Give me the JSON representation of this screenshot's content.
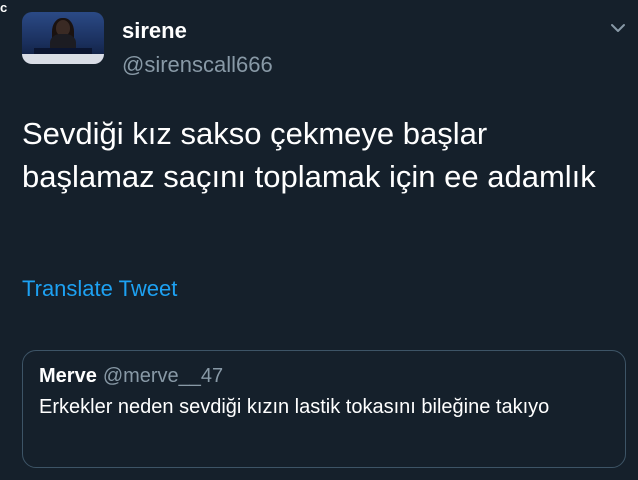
{
  "status_bar": {
    "fragment": "c"
  },
  "tweet": {
    "author": {
      "display_name": "sirene",
      "handle": "@sirenscall666"
    },
    "text": "Sevdiği kız sakso çekmeye başlar başlamaz saçını toplamak için ee adamlık",
    "translate_label": "Translate Tweet",
    "menu_icon": "chevron-down-icon"
  },
  "quoted_tweet": {
    "display_name": "Merve",
    "handle": "@merve__47",
    "text": "Erkekler neden sevdiği kızın lastik tokasını bileğine takıyo"
  },
  "colors": {
    "background": "#15202b",
    "text_primary": "#ffffff",
    "text_secondary": "#8899a6",
    "link": "#1da1f2",
    "border": "#3d5466"
  }
}
